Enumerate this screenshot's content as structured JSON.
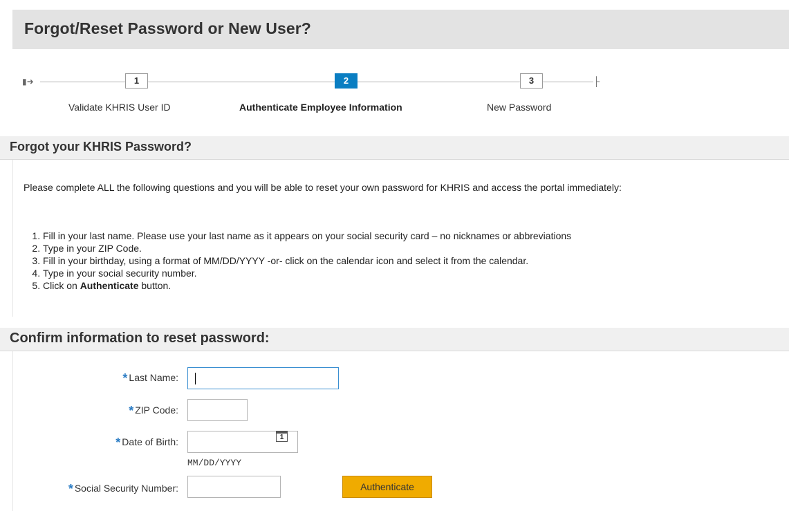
{
  "page": {
    "title": "Forgot/Reset Password or New User?"
  },
  "roadmap": {
    "steps": [
      {
        "number": "1",
        "label": "Validate KHRIS User ID",
        "active": false
      },
      {
        "number": "2",
        "label": "Authenticate Employee Information",
        "active": true
      },
      {
        "number": "3",
        "label": "New Password",
        "active": false
      }
    ],
    "active_color": "#0a7ec2"
  },
  "forgot_section": {
    "heading": "Forgot your KHRIS Password?",
    "intro": "Please complete ALL the following questions and you will be able to reset your own password for KHRIS and access the portal immediately:",
    "steps": [
      "Fill in your last name. Please use your last name as it appears on your social security card – no nicknames or abbreviations",
      "Type in your ZIP Code.",
      "Fill in your birthday, using a format of MM/DD/YYYY -or- click on the calendar icon and select it from the calendar.",
      "Type in your social security number."
    ],
    "step5_prefix": "Click on ",
    "step5_bold": "Authenticate",
    "step5_suffix": " button."
  },
  "confirm_section": {
    "heading": "Confirm information to reset password:",
    "required_marker": "*",
    "fields": {
      "last_name": {
        "label": "Last Name:",
        "value": ""
      },
      "zip": {
        "label": "ZIP Code:",
        "value": ""
      },
      "dob": {
        "label": "Date of Birth:",
        "value": "",
        "calendar_day": "1",
        "hint": "MM/DD/YYYY"
      },
      "ssn": {
        "label": "Social Security Number:",
        "value": ""
      }
    },
    "authenticate_label": "Authenticate",
    "button_color": "#f0ab00",
    "required_color": "#2b7cc4"
  }
}
